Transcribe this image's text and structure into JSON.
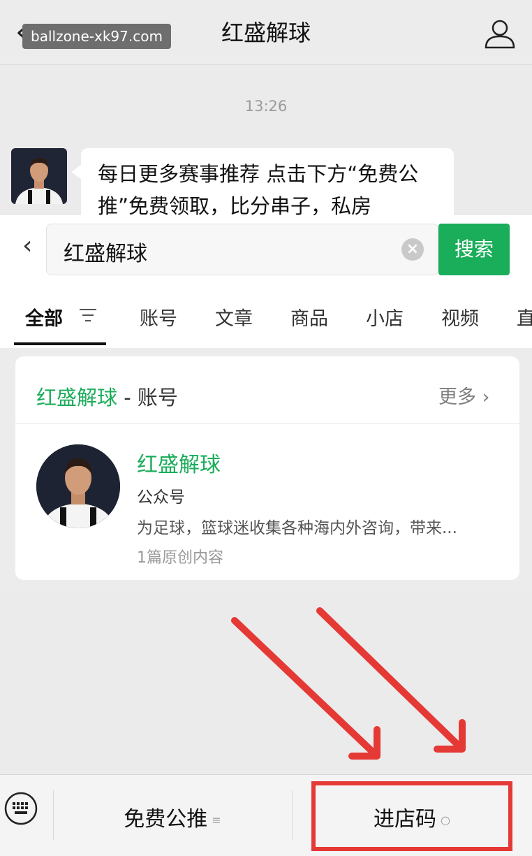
{
  "header": {
    "watermark": "ballzone-xk97.com",
    "title": "红盛解球"
  },
  "chat": {
    "time": "13:26",
    "message": "每日更多赛事推荐 点击下方“免费公推”免费领取，比分串子，私房"
  },
  "search": {
    "query": "红盛解球",
    "button": "搜索",
    "tabs": [
      "全部",
      "账号",
      "文章",
      "商品",
      "小店",
      "视频",
      "直"
    ]
  },
  "result": {
    "section_name": "红盛解球",
    "section_suffix": " - 账号",
    "more": "更多",
    "name": "红盛解球",
    "type": "公众号",
    "description": "为足球，篮球迷收集各种海内外咨询，带来...",
    "count": "1篇原创内容"
  },
  "menu": {
    "item1": "免费公推",
    "item2": "进店码"
  },
  "colors": {
    "accent": "#1aad5a",
    "highlight": "#e53935"
  }
}
